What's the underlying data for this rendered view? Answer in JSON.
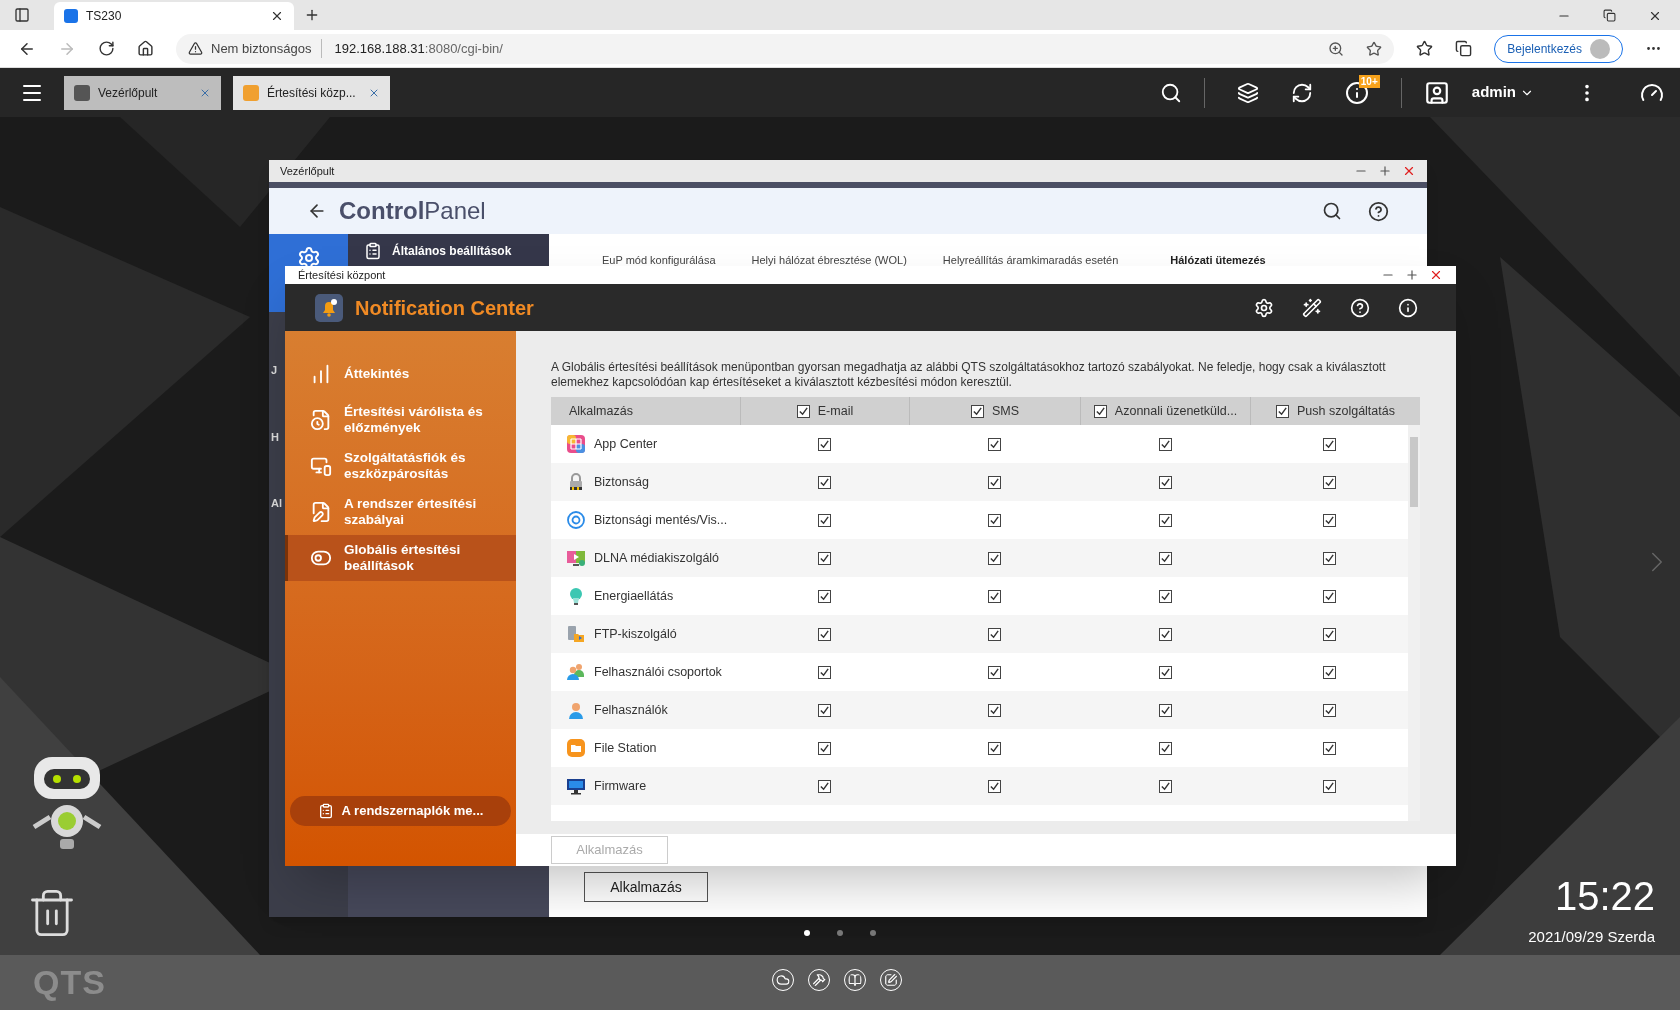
{
  "browser": {
    "tab_title": "TS230",
    "security": "Nem biztonságos",
    "url_host": "192.168.188.31",
    "url_rest": ":8080/cgi-bin/",
    "sign_in": "Bejelentkezés"
  },
  "qts_bar": {
    "tabs": [
      {
        "label": "Vezérlőpult",
        "selected": false
      },
      {
        "label": "Értesítési közp...",
        "selected": true
      }
    ],
    "badge": "10+",
    "user": "admin"
  },
  "control_panel": {
    "title": "Vezérlőpult",
    "heading_bold": "Control",
    "heading_light": "Panel",
    "sidebar_item": "Általános beállítások",
    "tabs": [
      {
        "label": "EuP mód konfigurálása",
        "selected": false
      },
      {
        "label": "Helyi hálózat ébresztése (WOL)",
        "selected": false
      },
      {
        "label": "Helyreállítás áramkimaradás esetén",
        "selected": false
      },
      {
        "label": "Hálózati ütemezés",
        "selected": true
      }
    ],
    "side_labels": [
      "J",
      "H",
      "Al"
    ],
    "apply": "Alkalmazás"
  },
  "notification_center": {
    "window_title": "Értesítési központ",
    "app_title": "Notification Center",
    "nav": [
      {
        "label": "Áttekintés",
        "selected": false
      },
      {
        "label": "Értesítési várólista és előzmények",
        "selected": false
      },
      {
        "label": "Szolgáltatásfiók és eszközpárosítás",
        "selected": false
      },
      {
        "label": "A rendszer értesítési szabályai",
        "selected": false
      },
      {
        "label": "Globális értesítési beállítások",
        "selected": true
      }
    ],
    "log_button": "A rendszernaplók me...",
    "description": "A Globális értesítési beállítások menüpontban gyorsan megadhatja az alábbi QTS szolgáltatásokhoz tartozó szabályokat. Ne feledje, hogy csak a kiválasztott elemekhez kapcsolódóan kap értesítéseket a kiválasztott kézbesítési módon keresztül.",
    "columns": [
      {
        "label": "Alkalmazás"
      },
      {
        "label": "E-mail",
        "checked": true
      },
      {
        "label": "SMS",
        "checked": true
      },
      {
        "label": "Azonnali üzenetküld...",
        "checked": true
      },
      {
        "label": "Push szolgáltatás",
        "checked": true
      }
    ],
    "rows": [
      {
        "name": "App Center",
        "checks": [
          true,
          true,
          true,
          true
        ]
      },
      {
        "name": "Biztonság",
        "checks": [
          true,
          true,
          true,
          true
        ]
      },
      {
        "name": "Biztonsági mentés/Vis...",
        "checks": [
          true,
          true,
          true,
          true
        ]
      },
      {
        "name": "DLNA médiakiszolgáló",
        "checks": [
          true,
          true,
          true,
          true
        ]
      },
      {
        "name": "Energiaellátás",
        "checks": [
          true,
          true,
          true,
          true
        ]
      },
      {
        "name": "FTP-kiszolgáló",
        "checks": [
          true,
          true,
          true,
          true
        ]
      },
      {
        "name": "Felhasználói csoportok",
        "checks": [
          true,
          true,
          true,
          true
        ]
      },
      {
        "name": "Felhasználók",
        "checks": [
          true,
          true,
          true,
          true
        ]
      },
      {
        "name": "File Station",
        "checks": [
          true,
          true,
          true,
          true
        ]
      },
      {
        "name": "Firmware",
        "checks": [
          true,
          true,
          true,
          true
        ]
      }
    ],
    "apply": {
      "label": "Alkalmazás",
      "disabled": true
    }
  },
  "desktop": {
    "clock": "15:22",
    "date": "2021/09/29 Szerda",
    "pages": [
      {
        "selected": true
      },
      {
        "selected": false
      },
      {
        "selected": false
      }
    ],
    "logo": "QTS"
  }
}
